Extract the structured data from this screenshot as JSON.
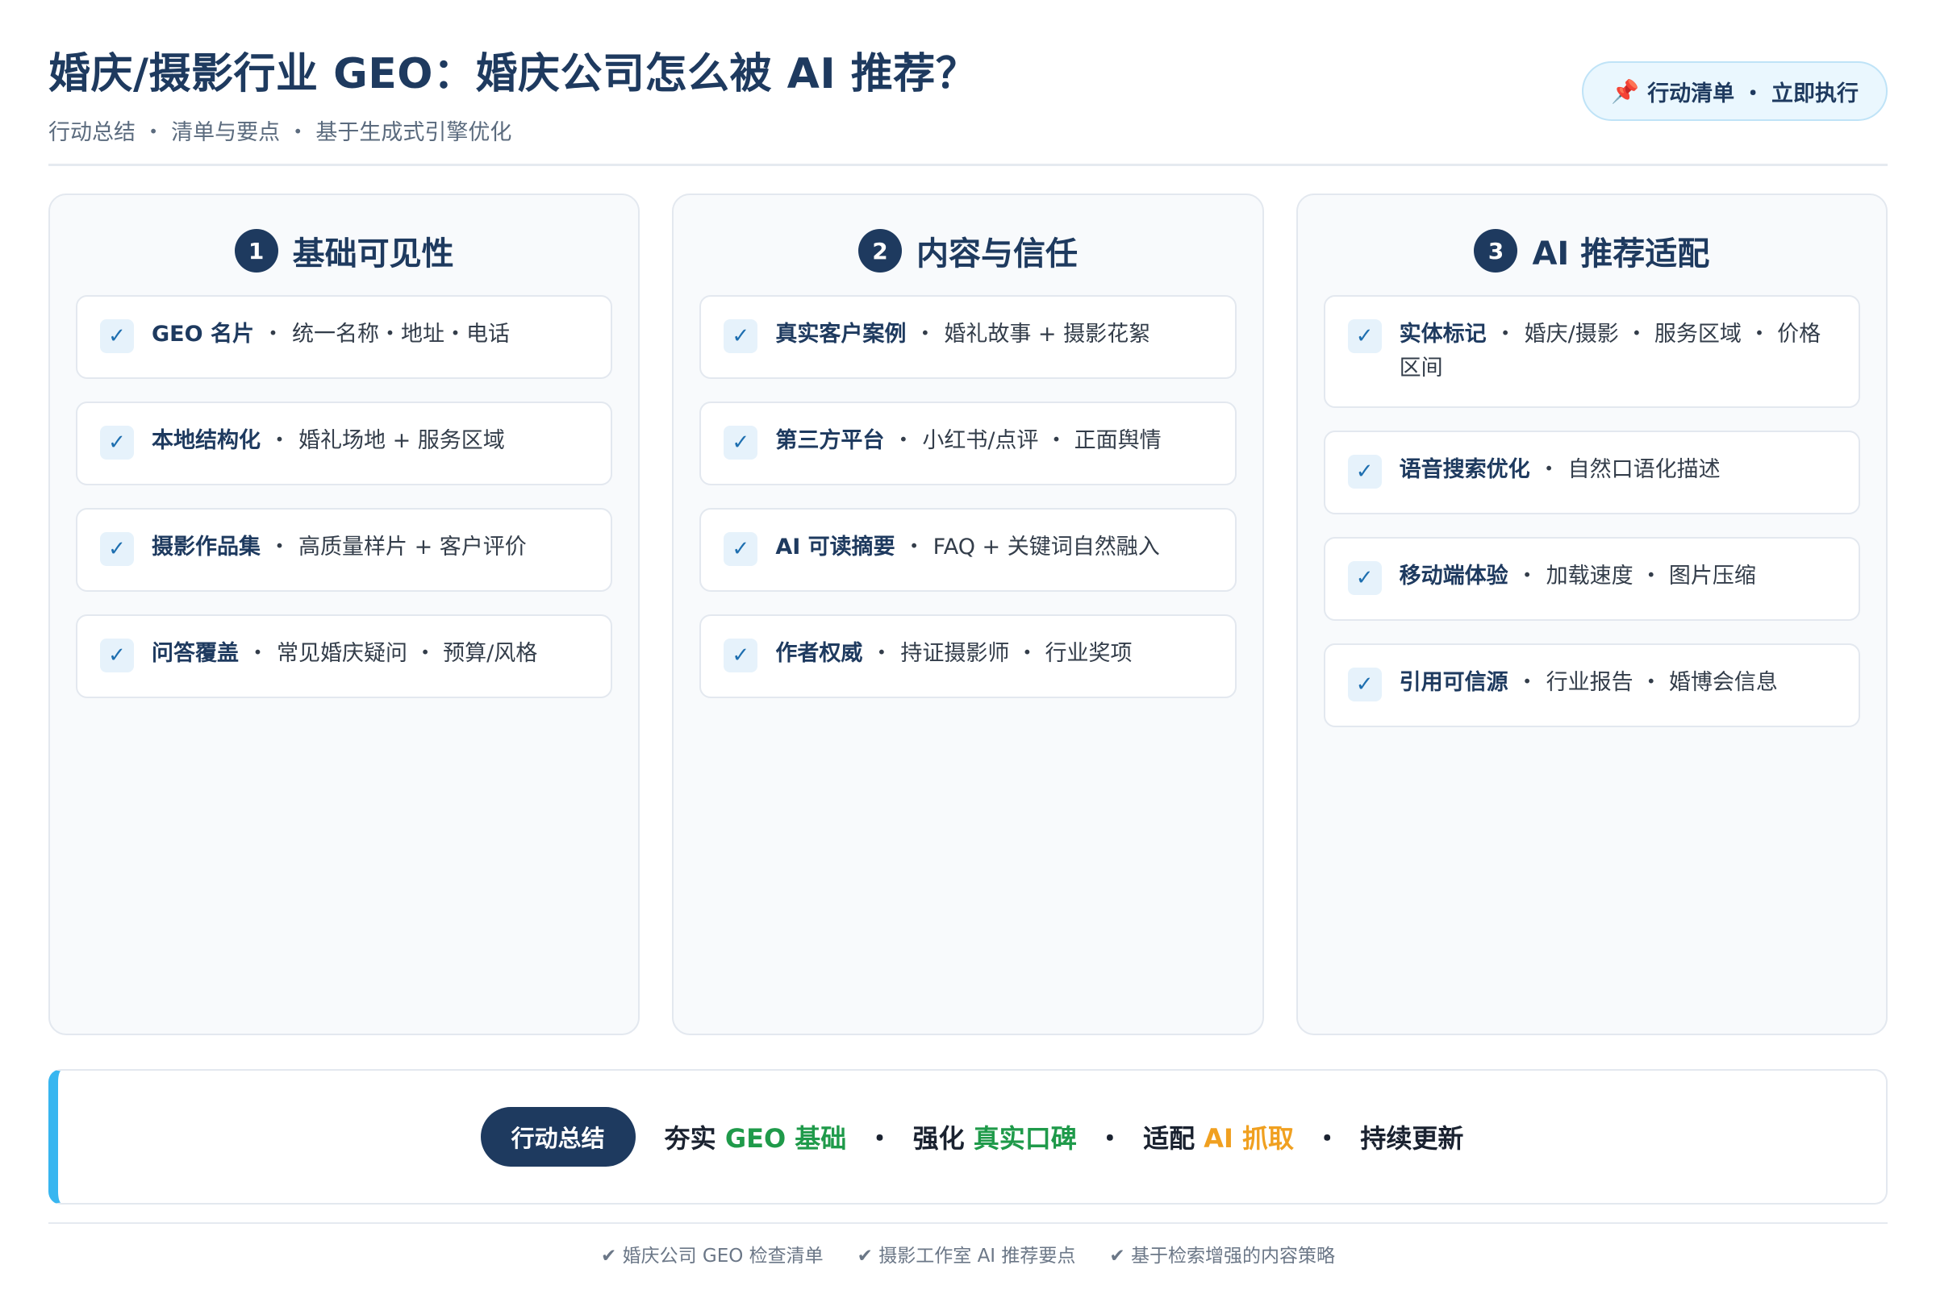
{
  "header": {
    "title": "婚庆/摄影行业 GEO：婚庆公司怎么被 AI 推荐？",
    "subtitle": "行动总结 ・ 清单与要点 ・ 基于生成式引擎优化",
    "badge": "行动清单 ・ 立即执行",
    "badge_icon": "pushpin-icon"
  },
  "columns": [
    {
      "num": "1",
      "title": "基础可见性",
      "items": [
        {
          "key": "GEO 名片",
          "text": "统一名称・地址・电话"
        },
        {
          "key": "本地结构化",
          "text": "婚礼场地 + 服务区域"
        },
        {
          "key": "摄影作品集",
          "text": "高质量样片 + 客户评价"
        },
        {
          "key": "问答覆盖",
          "text": "常见婚庆疑问 ・ 预算/风格"
        }
      ]
    },
    {
      "num": "2",
      "title": "内容与信任",
      "items": [
        {
          "key": "真实客户案例",
          "text": "婚礼故事 + 摄影花絮"
        },
        {
          "key": "第三方平台",
          "text": "小红书/点评 ・ 正面舆情"
        },
        {
          "key": "AI 可读摘要",
          "text": "FAQ + 关键词自然融入"
        },
        {
          "key": "作者权威",
          "text": "持证摄影师 ・ 行业奖项"
        }
      ]
    },
    {
      "num": "3",
      "title": "AI 推荐适配",
      "items": [
        {
          "key": "实体标记",
          "text": "婚庆/摄影 ・ 服务区域 ・ 价格区间"
        },
        {
          "key": "语音搜索优化",
          "text": "自然口语化描述"
        },
        {
          "key": "移动端体验",
          "text": "加载速度 ・ 图片压缩"
        },
        {
          "key": "引用可信源",
          "text": "行业报告 ・ 婚博会信息"
        }
      ]
    }
  ],
  "summary": {
    "pill": "行动总结",
    "parts": [
      {
        "a": "夯实 ",
        "b": "GEO 基础"
      },
      {
        "a": "强化 ",
        "b": "真实口碑"
      },
      {
        "a": "适配 ",
        "b": "AI 抓取"
      },
      {
        "a": "持续更新",
        "b": ""
      }
    ],
    "separator": "・"
  },
  "footer": [
    "✔ 婚庆公司 GEO 检查清单",
    "✔ 摄影工作室 AI 推荐要点",
    "✔ 基于检索增强的内容策略"
  ],
  "colors": {
    "primary": "#1e3a5f",
    "accent": "#38b6f0",
    "green": "#1f9a4a",
    "orange": "#f0a020"
  },
  "check_symbol": "✓",
  "item_separator": "・"
}
